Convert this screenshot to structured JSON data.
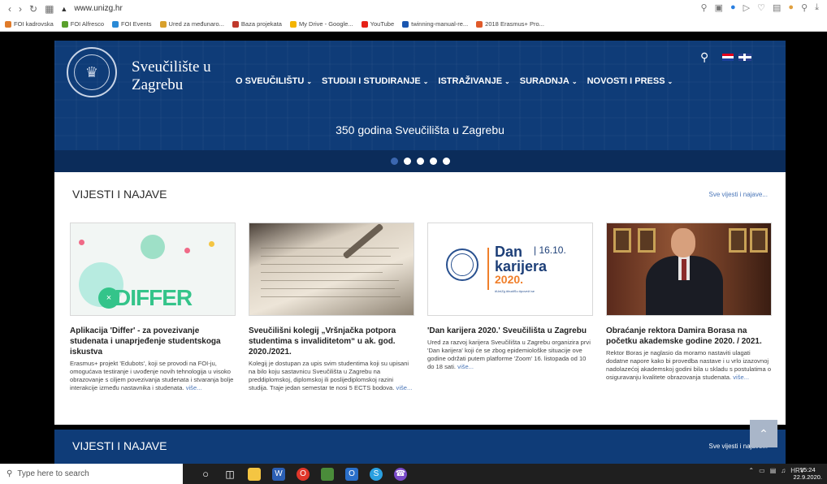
{
  "browser": {
    "url": "www.unizg.hr",
    "bookmarks": [
      {
        "label": "FOI kadrovska",
        "color": "#e07b2a"
      },
      {
        "label": "FOI Alfresco",
        "color": "#5aa02c"
      },
      {
        "label": "FOI Events",
        "color": "#2a8ad6"
      },
      {
        "label": "Ured za međunaro...",
        "color": "#d8a02c"
      },
      {
        "label": "Baza projekata",
        "color": "#c0392b"
      },
      {
        "label": "My Drive - Google...",
        "color": "#f4b400"
      },
      {
        "label": "YouTube",
        "color": "#e62117"
      },
      {
        "label": "twinning-manual-re...",
        "color": "#1a56b0"
      },
      {
        "label": "2018 Erasmus+ Pro...",
        "color": "#e05a2a"
      }
    ]
  },
  "header": {
    "uni_line1": "Sveučilište u",
    "uni_line2": "Zagrebu",
    "nav": [
      "O SVEUČILIŠTU",
      "STUDIJI I STUDIRANJE",
      "ISTRAŽIVANJE",
      "SURADNJA",
      "NOVOSTI I PRESS"
    ],
    "slogan": "350 godina Sveučilišta u Zagrebu",
    "slider_active_index": 0
  },
  "news": {
    "title": "VIJESTI I NAJAVE",
    "all_link": "Sve vijesti i najave...",
    "more": "više...",
    "cards": [
      {
        "title": "Aplikacija 'Differ' - za povezivanje studenata i unaprjeđenje studentskoga iskustva",
        "text": "Erasmus+ projekt 'Edubots', koji se provodi na FOI-ju, omogućava testiranje i uvođenje novih tehnologija u visoko obrazovanje s ciljem povezivanja studenata i stvaranja bolje interakcije između nastavnika i studenata.",
        "image_word": "DIFFER"
      },
      {
        "title": "Sveučilišni kolegij „Vršnjačka potpora studentima s invaliditetom“ u ak. god. 2020./2021.",
        "text": "Kolegij je dostupan za upis svim studentima koji su upisani na bilo koju sastavnicu Sveučilišta u Zagrebu na preddiplomskoj, diplomskoj ili poslijediplomskoj razini studija. Traje jedan semestar te nosi 5 ECTS bodova."
      },
      {
        "title": "'Dan karijera 2020.' Sveučilišta u Zagrebu",
        "text": "Ured za razvoj karijera Sveučilišta u Zagrebu organizira prvi 'Dan karijera' koji će se zbog epidemiološke situacije ove godine održati putem platforme 'Zoom' 16. listopada od 10 do 18 sati.",
        "image_title": "Dan karijera",
        "image_year": "2020.",
        "image_date": "| 16.10.",
        "image_sub": "#UniZg #budiSu #poveži se"
      },
      {
        "title": "Obraćanje rektora Damira Borasa na početku akademske godine 2020. / 2021.",
        "text": "Rektor Boras je naglasio da moramo nastaviti ulagati dodatne napore kako bi provedba nastave i u vrlo izazovnoj nadolazećoj akademskoj godini bila u skladu s postulatima o osiguravanju kvalitete obrazovanja studenata."
      }
    ]
  },
  "section2": {
    "title": "VIJESTI I NAJAVE",
    "all_link": "Sve vijesti i najave..."
  },
  "taskbar": {
    "search_placeholder": "Type here to search",
    "lang": "HRV",
    "time": "15:24",
    "date": "22.9.2020."
  }
}
